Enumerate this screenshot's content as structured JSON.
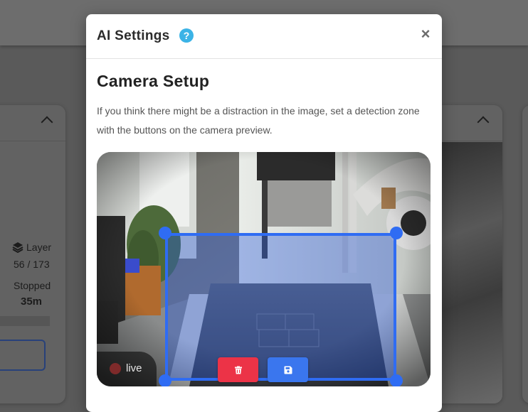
{
  "background": {
    "layer_label": "Layer",
    "layer_progress": "56 / 173",
    "status": "Stopped",
    "duration": "35m",
    "icons": [
      "layers-icon",
      "chevron-up-icon"
    ]
  },
  "modal": {
    "title": "AI Settings",
    "help_icon": "?",
    "close_icon": "×",
    "section_title": "Camera Setup",
    "description": "If you think there might be a distraction in the image, set a detection zone with the buttons on the camera preview.",
    "preview": {
      "live_label": "live",
      "delete_zone_icon": "trash-icon",
      "save_zone_icon": "save-icon"
    }
  },
  "colors": {
    "accent_blue": "#2f6cf3",
    "delete_red": "#ec3347",
    "help_blue": "#3bb3e6"
  }
}
